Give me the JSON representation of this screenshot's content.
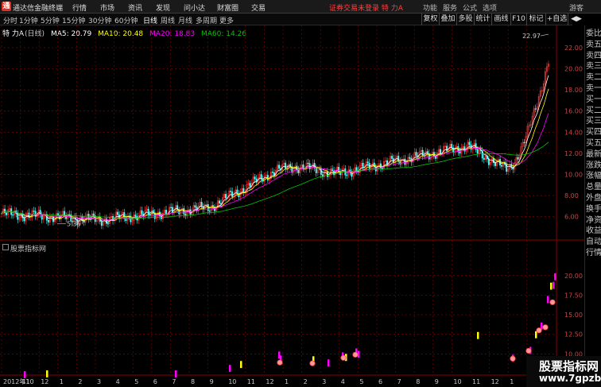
{
  "app": {
    "name": "通达信金融终端",
    "logo": "通"
  },
  "menu": [
    "行情",
    "市场",
    "资讯",
    "发现",
    "问小达",
    "财富圈",
    "交易"
  ],
  "alert": "证券交易未登录 特 力A",
  "window_controls": [
    "功能",
    "服务",
    "公式",
    "选项",
    "游客"
  ],
  "periods": [
    "分时",
    "1分钟",
    "5分钟",
    "15分钟",
    "30分钟",
    "60分钟",
    "日线",
    "周线",
    "月线",
    "多周期",
    "更多"
  ],
  "selected_period": "日线",
  "toolbar": [
    "复权",
    "叠加",
    "多股",
    "统计",
    "画线",
    "F10",
    "标记",
    "+自选",
    "◀▶"
  ],
  "legend": {
    "stock": "特 力A",
    "period": "(日线)",
    "ma5": "MA5: 20.79",
    "ma10": "MA10: 20.48",
    "ma20": "MA20: 18.83",
    "ma60": "MA60: 14.26"
  },
  "colors": {
    "up": "#ff3232",
    "down": "#54ffff",
    "ma5": "#ffffff",
    "ma10": "#ffff00",
    "ma20": "#ff00ff",
    "ma60": "#00c800",
    "grid": "#8b0000",
    "text": "#c8c8c8"
  },
  "side_panel": [
    "委比",
    "卖五",
    "卖四",
    "卖三",
    "卖二",
    "卖一",
    "买一",
    "买二",
    "买三",
    "买四",
    "买五",
    "最新",
    "涨跌",
    "涨幅",
    "总量",
    "外盘",
    "换手",
    "净资",
    "收益",
    "自动",
    "行情"
  ],
  "main_chart": {
    "y_labels": [
      "22.00",
      "20.00",
      "18.00",
      "16.00",
      "14.00",
      "12.00",
      "10.00",
      "8.00",
      "6.00"
    ],
    "high_label": "22.97",
    "low_label": "5.35"
  },
  "indicator": {
    "title": "股票指标网",
    "y_labels": [
      "20.00",
      "17.50",
      "15.00",
      "12.50",
      "10.00"
    ]
  },
  "x_axis": [
    "2012年10",
    "11",
    "12",
    "1",
    "2",
    "3",
    "4",
    "5",
    "6",
    "7",
    "8",
    "9",
    "10",
    "11",
    "12",
    "1",
    "2",
    "3",
    "4",
    "5",
    "6",
    "7",
    "8",
    "9",
    "10",
    "11",
    "12",
    "1",
    "2"
  ],
  "watermark": {
    "line1": "股票指标网",
    "line2": "www.7gpzb.com"
  }
}
